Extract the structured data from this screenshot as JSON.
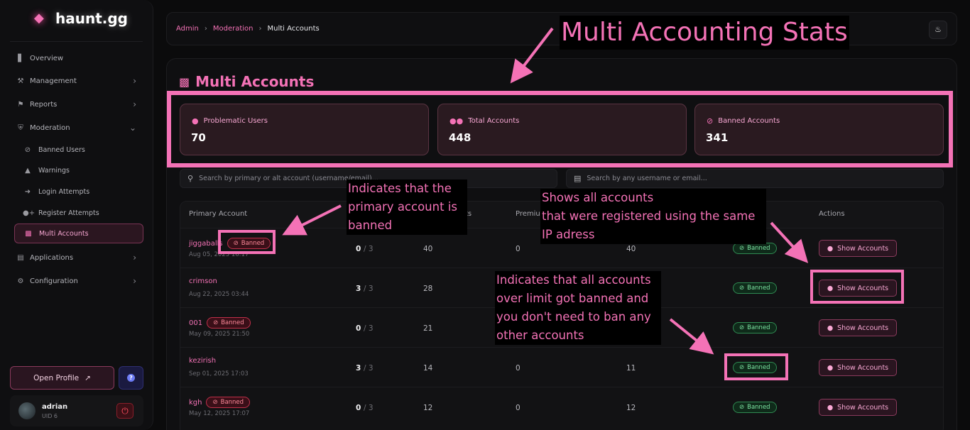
{
  "brand": {
    "name": "haunt.gg",
    "icon": "ghost-logo-icon"
  },
  "sidebar": {
    "items": [
      {
        "label": "Overview",
        "icon": "chart-bar-icon"
      },
      {
        "label": "Management",
        "icon": "hammer-icon"
      },
      {
        "label": "Reports",
        "icon": "flag-icon"
      },
      {
        "label": "Moderation",
        "icon": "shield-icon"
      },
      {
        "label": "Banned Users",
        "icon": "ban-icon"
      },
      {
        "label": "Warnings",
        "icon": "warning-icon"
      },
      {
        "label": "Login Attempts",
        "icon": "sign-in-icon"
      },
      {
        "label": "Register Attempts",
        "icon": "user-plus-icon"
      },
      {
        "label": "Multi Accounts",
        "icon": "sitemap-icon"
      },
      {
        "label": "Applications",
        "icon": "file-icon"
      },
      {
        "label": "Configuration",
        "icon": "gear-icon"
      }
    ],
    "open_profile": "Open Profile",
    "user": {
      "name": "adrian",
      "uid": "UID 6"
    }
  },
  "breadcrumb": {
    "admin": "Admin",
    "moderation": "Moderation",
    "current": "Multi Accounts"
  },
  "page": {
    "title": "Multi Accounts",
    "stats": [
      {
        "label": "Problematic Users",
        "value": "70",
        "icon": "user-icon"
      },
      {
        "label": "Total Accounts",
        "value": "448",
        "icon": "users-icon"
      },
      {
        "label": "Banned Accounts",
        "value": "341",
        "icon": "ban-icon"
      }
    ],
    "search_primary_placeholder": "Search by primary or alt account (username/email)...",
    "search_any_placeholder": "Search by any username or email..."
  },
  "table": {
    "headers": {
      "primary": "Primary Account",
      "c3": "ts",
      "c4": "Premium",
      "actions": "Actions"
    },
    "banned_label": "Banned",
    "show_label": "Show Accounts",
    "rows": [
      {
        "name": "jiggaballs",
        "date": "Aug 05, 2025 16:17",
        "banned": true,
        "count": "0",
        "limit": "/ 3",
        "c3": "40",
        "c4": "0",
        "c5": "40"
      },
      {
        "name": "crimson",
        "date": "Aug 22, 2025 03:44",
        "banned": false,
        "count": "3",
        "limit": "/ 3",
        "c3": "28",
        "c4": "",
        "c5": ""
      },
      {
        "name": "001",
        "date": "May 09, 2025 21:50",
        "banned": true,
        "count": "0",
        "limit": "/ 3",
        "c3": "21",
        "c4": "",
        "c5": ""
      },
      {
        "name": "kezirish",
        "date": "Sep 01, 2025 17:03",
        "banned": false,
        "count": "3",
        "limit": "/ 3",
        "c3": "14",
        "c4": "0",
        "c5": "11"
      },
      {
        "name": "kgh",
        "date": "May 12, 2025 17:07",
        "banned": true,
        "count": "0",
        "limit": "/ 3",
        "c3": "12",
        "c4": "0",
        "c5": "12"
      }
    ]
  },
  "annotations": {
    "title": "Multi Accounting Stats",
    "primary_banned": [
      "Indicates that the",
      "primary account is",
      "banned"
    ],
    "show_accounts": [
      "Shows all accounts",
      "that were registered using the same",
      "IP adress"
    ],
    "all_banned": [
      "Indicates that all accounts",
      "over limit got banned and",
      "you don't need to ban any",
      "other accounts"
    ]
  },
  "colors": {
    "accent": "#f472b6",
    "background": "#0b0b0c",
    "banned_red": "#ff8a9a",
    "banned_green": "#7ee6a4"
  }
}
